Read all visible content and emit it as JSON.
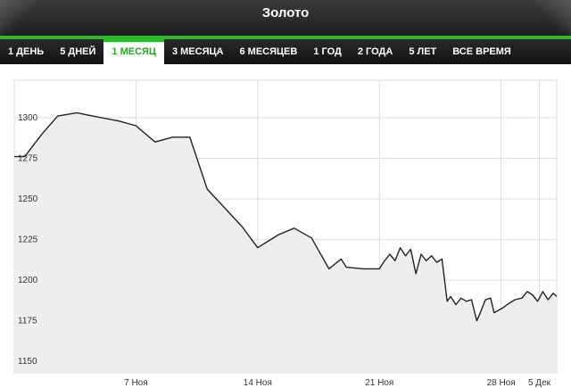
{
  "title": "Золото",
  "tabs": [
    {
      "label": "1 ДЕНЬ",
      "active": false
    },
    {
      "label": "5 ДНЕЙ",
      "active": false
    },
    {
      "label": "1 МЕСЯЦ",
      "active": true
    },
    {
      "label": "3 МЕСЯЦА",
      "active": false
    },
    {
      "label": "6 МЕСЯЦЕВ",
      "active": false
    },
    {
      "label": "1 ГОД",
      "active": false
    },
    {
      "label": "2 ГОДА",
      "active": false
    },
    {
      "label": "5 ЛЕТ",
      "active": false
    },
    {
      "label": "ВСЕ ВРЕМЯ",
      "active": false
    }
  ],
  "colors": {
    "accent": "#2db82d",
    "line": "#222222",
    "area": "#eeeeee",
    "grid": "#dddddd"
  },
  "chart_data": {
    "type": "area",
    "title": "",
    "xlabel": "",
    "ylabel": "",
    "ylim": [
      1143,
      1323
    ],
    "xlim": [
      0,
      31.2
    ],
    "grid": true,
    "y_ticks": [
      1300,
      1275,
      1250,
      1225,
      1200,
      1175,
      1150
    ],
    "x_ticks": [
      {
        "label": "7 Ноя",
        "x": 7
      },
      {
        "label": "14 Ноя",
        "x": 14
      },
      {
        "label": "21 Ноя",
        "x": 21
      },
      {
        "label": "28 Ноя",
        "x": 28
      },
      {
        "label": "5 Дек",
        "x": 30.2
      }
    ],
    "series": [
      {
        "x": [
          0,
          0.6,
          1.6,
          2.5,
          3.6,
          4.5,
          6.0,
          7.0,
          8.1,
          9.1,
          10.1,
          11.1,
          13.1,
          14.0,
          15.2,
          16.1,
          17.1,
          18.1,
          18.8,
          19.1,
          20.1,
          21.0,
          21.3,
          21.6,
          21.9,
          22.2,
          22.5,
          22.8,
          23.1,
          23.4,
          23.7,
          24.0,
          24.3,
          24.6,
          24.9,
          25.1,
          25.4,
          25.7,
          26.0,
          26.3,
          26.6,
          26.8,
          27.1,
          27.4,
          27.6,
          28.1,
          28.5,
          28.8,
          29.2,
          29.5,
          29.8,
          30.1,
          30.4,
          30.7,
          31.0,
          31.2
        ],
        "values": [
          1276,
          1276,
          1290,
          1301,
          1303,
          1301,
          1298,
          1295,
          1285,
          1288,
          1288,
          1256,
          1233,
          1220,
          1228,
          1232,
          1226,
          1207,
          1213,
          1208,
          1207,
          1207,
          1212,
          1216,
          1212,
          1220,
          1215,
          1219,
          1204,
          1216,
          1212,
          1215,
          1211,
          1213,
          1187,
          1190,
          1185,
          1189,
          1187,
          1188,
          1175,
          1180,
          1188,
          1189,
          1180,
          1183,
          1186,
          1188,
          1189,
          1193,
          1191,
          1187,
          1193,
          1188,
          1192,
          1190
        ]
      }
    ]
  }
}
